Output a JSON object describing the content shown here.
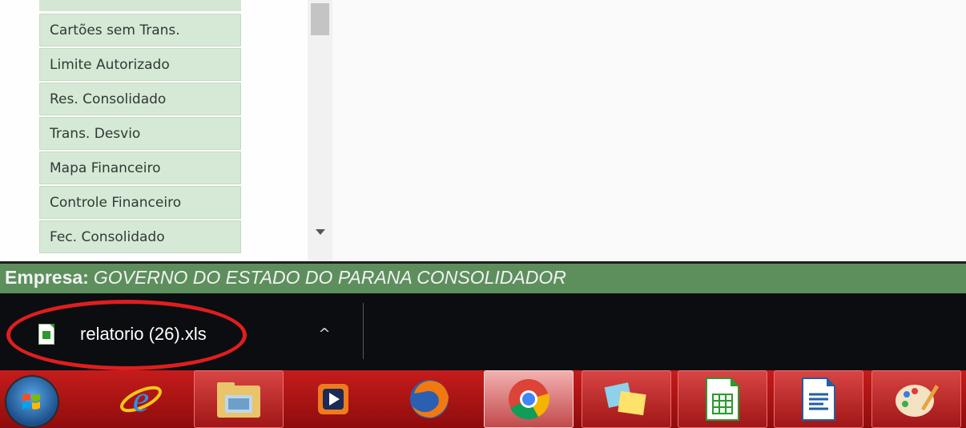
{
  "menu": {
    "items": [
      {
        "label": "Cartões sem Trans."
      },
      {
        "label": "Limite Autorizado"
      },
      {
        "label": "Res. Consolidado"
      },
      {
        "label": "Trans. Desvio"
      },
      {
        "label": "Mapa Financeiro"
      },
      {
        "label": "Controle Financeiro"
      },
      {
        "label": "Fec. Consolidado"
      }
    ]
  },
  "company": {
    "label": "Empresa:",
    "value": "GOVERNO DO ESTADO DO PARANA CONSOLIDADOR"
  },
  "download": {
    "filename": "relatorio (26).xls",
    "chevron": "^",
    "icon": "xls-file-icon"
  },
  "taskbar": {
    "start_icon": "windows-start-icon",
    "apps": [
      {
        "name": "internet-explorer",
        "icon": "internet-explorer-icon",
        "state": "pinned"
      },
      {
        "name": "file-explorer",
        "icon": "folder-icon",
        "state": "open"
      },
      {
        "name": "media-player",
        "icon": "media-player-icon",
        "state": "pinned"
      },
      {
        "name": "firefox",
        "icon": "firefox-icon",
        "state": "pinned"
      },
      {
        "name": "chrome",
        "icon": "chrome-icon",
        "state": "active"
      },
      {
        "name": "sticky-notes",
        "icon": "sticky-notes-icon",
        "state": "open"
      },
      {
        "name": "libreoffice-calc",
        "icon": "spreadsheet-icon",
        "state": "open"
      },
      {
        "name": "libreoffice-writer",
        "icon": "document-icon",
        "state": "open"
      },
      {
        "name": "paint",
        "icon": "paint-palette-icon",
        "state": "open"
      }
    ]
  },
  "colors": {
    "menu_item_bg": "#d6e8d6",
    "company_bar_bg": "#5d8f5d",
    "download_shelf_bg": "#0b0d10",
    "taskbar_bg": "#b21414",
    "highlight_oval": "#e01e1e"
  }
}
